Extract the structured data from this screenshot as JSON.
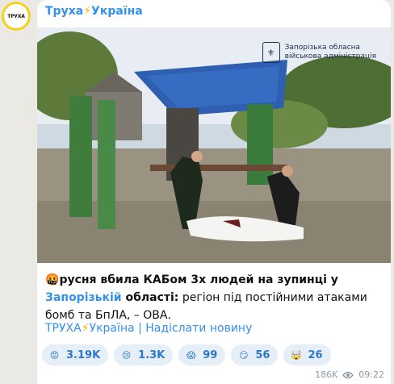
{
  "channel": {
    "name": "Труха",
    "bolt": "⚡",
    "name_suffix": "Україна",
    "avatar_text": "ТРУХА"
  },
  "photo": {
    "watermark_line1": "Запорізька обласна",
    "watermark_line2": "військова адміністрація"
  },
  "message": {
    "emoji": "🤬",
    "bold_part1": "русня вбила КАБом 3х людей на зупинці у ",
    "link_region": "Запорізькій",
    "bold_part2": " області:",
    "rest": " регіон під постійними атаками бомб та БпЛА, – ОВА."
  },
  "footer": {
    "link_part1": "ТРУХА",
    "bolt": "⚡",
    "link_part2": "Україна | Надіслати новину"
  },
  "reactions": [
    {
      "icon": "angry-face-icon",
      "glyph": "😡",
      "color": "#d8462c",
      "count": "3.19K"
    },
    {
      "icon": "crying-face-icon",
      "glyph": "😢",
      "color": "#f5c43a",
      "count": "1.3K"
    },
    {
      "icon": "screaming-face-icon",
      "glyph": "😱",
      "color": "#f5c43a",
      "count": "99"
    },
    {
      "icon": "smirk-face-icon",
      "glyph": "😏",
      "color": "#f5c43a",
      "count": "56"
    },
    {
      "icon": "exploding-head-icon",
      "glyph": "🤯",
      "color": "#f08a3a",
      "count": "26"
    }
  ],
  "meta": {
    "views": "186K",
    "time": "09:22"
  }
}
